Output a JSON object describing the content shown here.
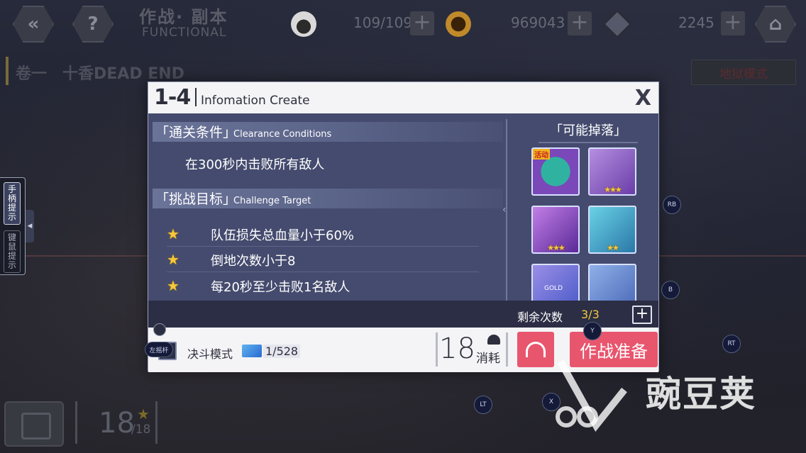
{
  "topbar": {
    "title_cn": "作战· 副本",
    "title_en": "FUNCTIONAL",
    "back_icon": "double-chevron-left-icon",
    "help_icon": "?",
    "stamina": "109/109",
    "coins": "969043",
    "gems": "2245"
  },
  "chapter": {
    "volume": "卷一",
    "name": "十香DEAD END",
    "hell_mode": "地狱模式"
  },
  "side_tabs": {
    "gamepad": "手柄提示",
    "keyboard": "键鼠提示"
  },
  "controller_hints": [
    "RB",
    "B",
    "RT",
    "Y",
    "LT",
    "X"
  ],
  "left_stick_label": "左摇杆",
  "dialog": {
    "stage": "1-4",
    "title": "Infomation Create",
    "close": "X",
    "clearance_cn": "「通关条件」",
    "clearance_en": "Clearance Conditions",
    "clearance_text": "在300秒内击败所有敌人",
    "challenge_cn": "「挑战目标」",
    "challenge_en": "Challenge Target",
    "targets": [
      "队伍损失总血量小于60%",
      "倒地次数小于8",
      "每20秒至少击败1名敌人"
    ],
    "drops_title": "「可能掉落」",
    "drop_event_badge": "活动",
    "ticket_text": "GOLD",
    "remain_label": "剩余次数",
    "remain_value": "3/3",
    "duel_mode": "决斗模式",
    "duel_count": "1/528",
    "cost": "18",
    "cost_label": "消耗",
    "ready_button": "作战准备"
  },
  "stars": {
    "current": "18",
    "total": "/18"
  },
  "watermark": "豌豆荚",
  "colors": {
    "accent_pink": "#e8566e",
    "star_gold": "#f5c83a",
    "panel": "#454b6e"
  }
}
